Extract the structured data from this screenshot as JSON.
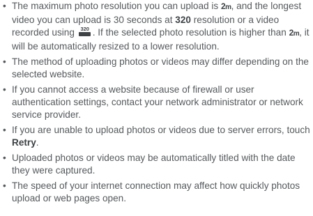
{
  "notes": [
    {
      "t1": "The maximum photo resolution you can upload is ",
      "icon_2m": "2",
      "icon_2m_sub": "m",
      "t2": ", and the longest video you can upload is 30 seconds at ",
      "bold": "320",
      "t3": " resolution or a video recorded using ",
      "video_icon_number": "320",
      "t4": ". If the selected photo resolution is higher than ",
      "t5": ", it will be automatically resized to a lower resolution."
    },
    {
      "text": "The method of uploading photos or videos may differ depending on the selected website."
    },
    {
      "text": "If you cannot access a website because of firewall or user authentication settings, contact your network administrator or network service provider."
    },
    {
      "before": "If you are unable to upload photos or videos due to server errors, touch ",
      "bold": "Retry",
      "after": "."
    },
    {
      "text": "Uploaded photos or videos may be automatically titled with the date they were captured."
    },
    {
      "text": "The speed of your internet connection may affect how quickly photos upload or web pages open."
    }
  ],
  "bullet_symbol": "•"
}
